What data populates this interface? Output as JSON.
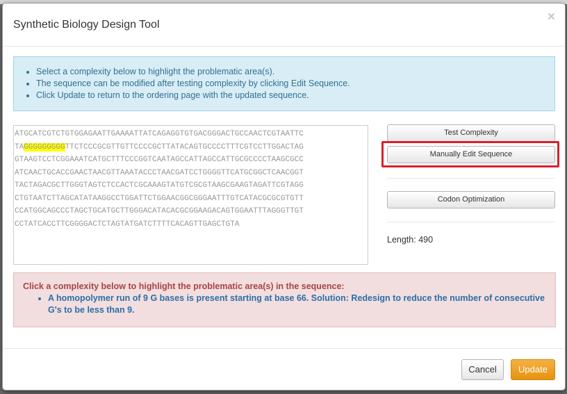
{
  "modal": {
    "title": "Synthetic Biology Design Tool",
    "close_symbol": "×"
  },
  "info": {
    "items": [
      "Select a complexity below to highlight the problematic area(s).",
      "The sequence can be modified after testing complexity by clicking Edit Sequence.",
      "Click Update to return to the ordering page with the updated sequence."
    ]
  },
  "sequence": {
    "lines": [
      "ATGCATCGTCTGTGGAGAATTGAAAATTATCAGAGGTGTGACGGGACTGCCAACTCGTAATTC",
      {
        "pre": "TA",
        "highlight": "GGGGGGGGG",
        "post": "TTCTCCCGCGTTGTTCCCCGCTTATACAGTGCCCCTTTCGTCCTTGGACTAG"
      },
      "GTAAGTCCTCGGAAATCATGCTTTCCCGGTCAATAGCCATTAGCCATTGCGCCCCTAAGCGCC",
      "ATCAACTGCACCGAACTAACGTTAAATACCCTAACGATCCTGGGGTTCATGCGGCTCAACGGT",
      "TACTAGACGCTTGGGTAGTCTCCACTCGCAAAGTATGTCGCGTAAGCGAAGTAGATTCGTAGG",
      "CTGTAATCTTAGCATATAAGGCCTGGATTCTGGAACGGCGGGAATTTGTCATACGCGCGTGTT",
      "CCATGGCAGCCCTAGCTGCATGCTTGGGACATACACGCGGAAGACAGTGGAATTTAGGGTTGT",
      "CCTATCACCTTCGGGGACTCTAGTATGATCTTTTCACAGTTGAGCTGTA"
    ],
    "highlight_color": "#ffff00"
  },
  "buttons": {
    "test_complexity": "Test Complexity",
    "manual_edit": "Manually Edit Sequence",
    "codon_optimization": "Codon Optimization",
    "cancel": "Cancel",
    "update": "Update"
  },
  "length": {
    "label": "Length:",
    "value": "490"
  },
  "complexity": {
    "title": "Click a complexity below to highlight the problematic area(s) in the sequence:",
    "items": [
      "A homopolymer run of 9 G bases is present starting at base 66. Solution: Redesign to reduce the number of consecutive G's to be less than 9."
    ]
  },
  "colors": {
    "update_button": "#f0a22a",
    "annotation_box": "#d9202c",
    "info_bg": "#d9edf7",
    "danger_bg": "#f2dede"
  }
}
